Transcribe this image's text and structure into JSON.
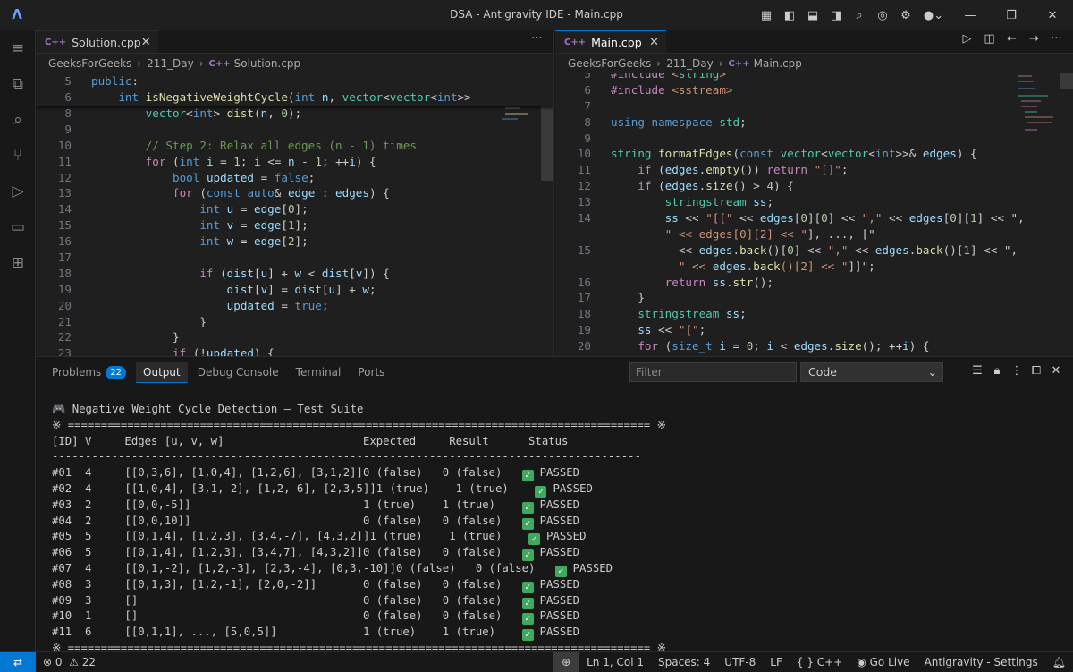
{
  "window": {
    "title": "DSA - Antigravity IDE - Main.cpp"
  },
  "left_editor": {
    "tab_label": "Solution.cpp",
    "breadcrumb": [
      "GeeksForGeeks",
      "211_Day",
      "Solution.cpp"
    ],
    "sticky_lines": [
      {
        "ln": "5",
        "code": "public:"
      },
      {
        "ln": "6",
        "code": "    int isNegativeWeightCycle(int n, vector<vector<int>>"
      }
    ],
    "lines": [
      {
        "ln": "8",
        "code": "        vector<int> dist(n, 0);"
      },
      {
        "ln": "9",
        "code": ""
      },
      {
        "ln": "10",
        "code": "        // Step 2: Relax all edges (n - 1) times"
      },
      {
        "ln": "11",
        "code": "        for (int i = 1; i <= n - 1; ++i) {"
      },
      {
        "ln": "12",
        "code": "            bool updated = false;"
      },
      {
        "ln": "13",
        "code": "            for (const auto& edge : edges) {"
      },
      {
        "ln": "14",
        "code": "                int u = edge[0];"
      },
      {
        "ln": "15",
        "code": "                int v = edge[1];"
      },
      {
        "ln": "16",
        "code": "                int w = edge[2];"
      },
      {
        "ln": "17",
        "code": ""
      },
      {
        "ln": "18",
        "code": "                if (dist[u] + w < dist[v]) {"
      },
      {
        "ln": "19",
        "code": "                    dist[v] = dist[u] + w;"
      },
      {
        "ln": "20",
        "code": "                    updated = true;"
      },
      {
        "ln": "21",
        "code": "                }"
      },
      {
        "ln": "22",
        "code": "            }"
      },
      {
        "ln": "23",
        "code": "            if (!updated) {"
      }
    ]
  },
  "right_editor": {
    "tab_label": "Main.cpp",
    "breadcrumb": [
      "GeeksForGeeks",
      "211_Day",
      "Main.cpp"
    ],
    "lines": [
      {
        "ln": "5",
        "code": "#include <string>"
      },
      {
        "ln": "6",
        "code": "#include <sstream>"
      },
      {
        "ln": "7",
        "code": ""
      },
      {
        "ln": "8",
        "code": "using namespace std;"
      },
      {
        "ln": "9",
        "code": ""
      },
      {
        "ln": "10",
        "code": "string formatEdges(const vector<vector<int>>& edges) {"
      },
      {
        "ln": "11",
        "code": "    if (edges.empty()) return \"[]\";"
      },
      {
        "ln": "12",
        "code": "    if (edges.size() > 4) {"
      },
      {
        "ln": "13",
        "code": "        stringstream ss;"
      },
      {
        "ln": "14",
        "code": "        ss << \"[[\" << edges[0][0] << \",\" << edges[0][1] << \","
      },
      {
        "ln": "",
        "code": "        \" << edges[0][2] << \"], ..., [\""
      },
      {
        "ln": "15",
        "code": "          << edges.back()[0] << \",\" << edges.back()[1] << \","
      },
      {
        "ln": "",
        "code": "          \" << edges.back()[2] << \"]]\";"
      },
      {
        "ln": "16",
        "code": "        return ss.str();"
      },
      {
        "ln": "17",
        "code": "    }"
      },
      {
        "ln": "18",
        "code": "    stringstream ss;"
      },
      {
        "ln": "19",
        "code": "    ss << \"[\";"
      },
      {
        "ln": "20",
        "code": "    for (size_t i = 0; i < edges.size(); ++i) {"
      }
    ]
  },
  "panel": {
    "tabs": [
      {
        "label": "Problems",
        "badge": "22"
      },
      {
        "label": "Output",
        "badge": ""
      },
      {
        "label": "Debug Console",
        "badge": ""
      },
      {
        "label": "Terminal",
        "badge": ""
      },
      {
        "label": "Ports",
        "badge": ""
      }
    ],
    "active_tab": "Output",
    "filter_placeholder": "Filter",
    "channel": "Code",
    "output": {
      "heading": "🎮 Negative Weight Cycle Detection — Test Suite",
      "rule_top": "※ ======================================================================================== ※",
      "header": "[ID] V     Edges [u, v, w]                     Expected     Result      Status",
      "rule": "-----------------------------------------------------------------------------------------",
      "rows": [
        {
          "text": "#01  4     [[0,3,6], [1,0,4], [1,2,6], [3,1,2]]0 (false)   0 (false)   ",
          "status": "PASSED"
        },
        {
          "text": "#02  4     [[1,0,4], [3,1,-2], [1,2,-6], [2,3,5]]1 (true)    1 (true)    ",
          "status": "PASSED"
        },
        {
          "text": "#03  2     [[0,0,-5]]                          1 (true)    1 (true)    ",
          "status": "PASSED"
        },
        {
          "text": "#04  2     [[0,0,10]]                          0 (false)   0 (false)   ",
          "status": "PASSED"
        },
        {
          "text": "#05  5     [[0,1,4], [1,2,3], [3,4,-7], [4,3,2]]1 (true)    1 (true)    ",
          "status": "PASSED"
        },
        {
          "text": "#06  5     [[0,1,4], [1,2,3], [3,4,7], [4,3,2]]0 (false)   0 (false)   ",
          "status": "PASSED"
        },
        {
          "text": "#07  4     [[0,1,-2], [1,2,-3], [2,3,-4], [0,3,-10]]0 (false)   0 (false)   ",
          "status": "PASSED"
        },
        {
          "text": "#08  3     [[0,1,3], [1,2,-1], [2,0,-2]]       0 (false)   0 (false)   ",
          "status": "PASSED"
        },
        {
          "text": "#09  3     []                                  0 (false)   0 (false)   ",
          "status": "PASSED"
        },
        {
          "text": "#10  1     []                                  0 (false)   0 (false)   ",
          "status": "PASSED"
        },
        {
          "text": "#11  6     [[0,1,1], ..., [5,0,5]]             1 (true)    1 (true)    ",
          "status": "PASSED"
        }
      ],
      "rule_bottom": "※ ======================================================================================== ※"
    }
  },
  "status_bar": {
    "errors": "0",
    "warnings": "22",
    "position": "Ln 1, Col 1",
    "spaces": "Spaces: 4",
    "encoding": "UTF-8",
    "eol": "LF",
    "language": "C++",
    "golive": "Go Live",
    "settings": "Antigravity - Settings"
  },
  "colors": {
    "accent": "#0078d4",
    "passed": "#41a85f"
  }
}
